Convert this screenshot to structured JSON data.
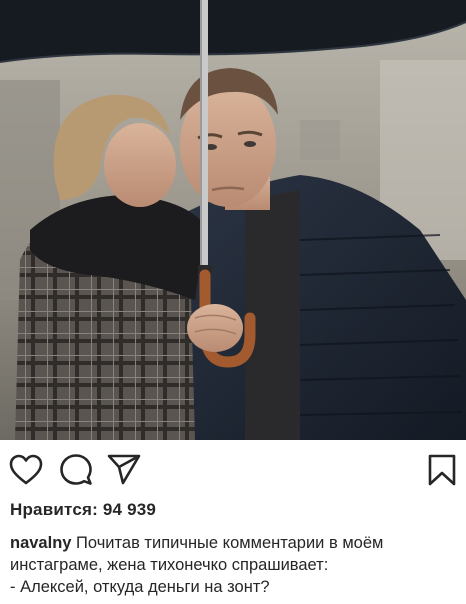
{
  "photo": {
    "alt_subject": "photo-of-couple-under-umbrella"
  },
  "actions": {
    "like_icon": "heart-icon",
    "comment_icon": "comment-bubble-icon",
    "share_icon": "paper-plane-icon",
    "save_icon": "bookmark-icon"
  },
  "likes": {
    "text": "Нравится: 94 939"
  },
  "caption": {
    "username": "navalny",
    "line1_rest": " Почитав типичные комментарии в моём",
    "line2": "инстаграме, жена тихонечко спрашивает:",
    "line3": "- Алексей, откуда деньги на зонт?"
  },
  "colors": {
    "text": "#262626",
    "background": "#ffffff"
  }
}
